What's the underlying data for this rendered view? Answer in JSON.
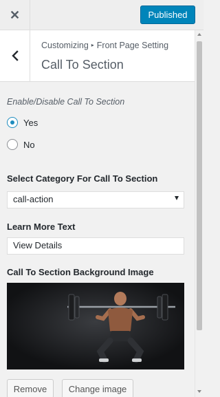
{
  "topbar": {
    "close_glyph": "✕",
    "publish_label": "Published",
    "accent_color": "#0085ba"
  },
  "header": {
    "breadcrumb_root": "Customizing",
    "breadcrumb_sep": "▸",
    "breadcrumb_parent": "Front Page Setting",
    "title": "Call To Section",
    "back_icon": "chevron-left-icon"
  },
  "controls": {
    "enable_title": "Enable/Disable Call To Section",
    "radio_options": [
      {
        "label": "Yes",
        "checked": true
      },
      {
        "label": "No",
        "checked": false
      }
    ],
    "category_title": "Select Category For Call To Section",
    "category_selected": "call-action",
    "learn_more_title": "Learn More Text",
    "learn_more_value": "View Details",
    "bg_image_title": "Call To Section Background Image",
    "remove_label": "Remove",
    "change_image_label": "Change image"
  }
}
